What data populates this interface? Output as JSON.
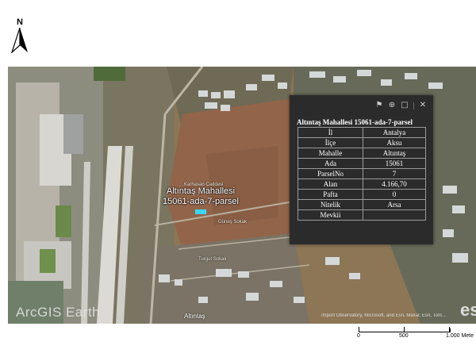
{
  "north_arrow": {
    "letter": "N"
  },
  "map": {
    "parcel_label_line1": "Altıntaş Mahallesi",
    "parcel_label_line2": "15061-ada-7-parsel",
    "watermark": "ArcGIS  Earth",
    "esri_logo": "es",
    "attribution": "Import Observatory, Microsoft, and Esri, Maxar, Esri, Tom...",
    "town": "Altıntaş",
    "streets": [
      "Karhasan Caddesi",
      "Güneş Sokak",
      "Turgut Sokak"
    ]
  },
  "popup": {
    "title": "Altıntaş Mahallesi 15061-ada-7-parsel",
    "tool_icons": [
      "pin-icon",
      "zoom-icon",
      "maximize-icon",
      "close-icon"
    ],
    "rows": [
      {
        "label": "İl",
        "value": "Antalya"
      },
      {
        "label": "İlçe",
        "value": "Aksu"
      },
      {
        "label": "Mahalle",
        "value": "Altıntaş"
      },
      {
        "label": "Ada",
        "value": "15061"
      },
      {
        "label": "ParselNo",
        "value": "7"
      },
      {
        "label": "Alan",
        "value": "4.166,70"
      },
      {
        "label": "Pafta",
        "value": "0"
      },
      {
        "label": "Nitelik",
        "value": "Arsa"
      },
      {
        "label": "Mevkii",
        "value": ""
      }
    ]
  },
  "scale_bar": {
    "labels": [
      "0",
      "500",
      "1.000 Mete"
    ]
  },
  "colors": {
    "parcel_highlight": "#3ad6f5",
    "popup_bg": "#2b2b2b"
  }
}
